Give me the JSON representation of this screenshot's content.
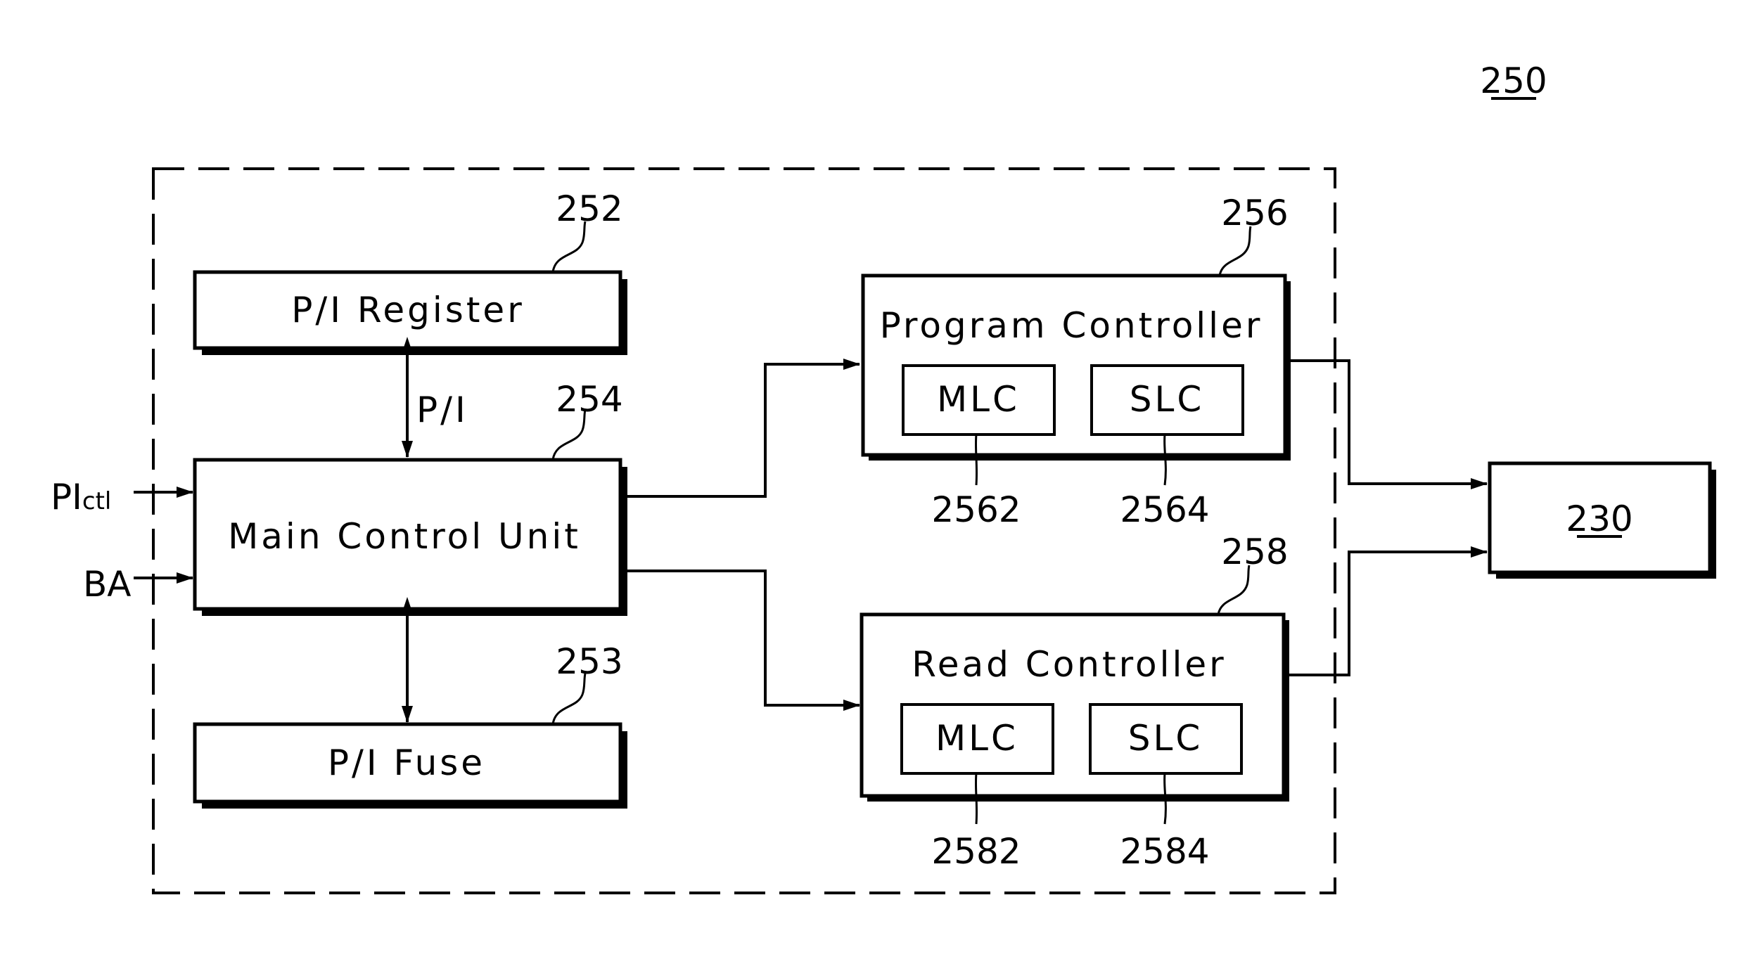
{
  "figure": {
    "ref_number": "250",
    "external_block": {
      "ref": "230"
    },
    "inputs": [
      {
        "label": "PI",
        "subscript": "ctl"
      },
      {
        "label": "BA"
      }
    ],
    "blocks": {
      "pi_register": {
        "label": "P/I Register",
        "ref": "252"
      },
      "main_control_unit": {
        "label": "Main Control Unit",
        "ref": "254"
      },
      "pi_fuse": {
        "label": "P/I Fuse",
        "ref": "253"
      },
      "program_controller": {
        "label": "Program Controller",
        "ref": "256",
        "sub_blocks": [
          {
            "label": "MLC",
            "ref": "2562"
          },
          {
            "label": "SLC",
            "ref": "2564"
          }
        ]
      },
      "read_controller": {
        "label": "Read Controller",
        "ref": "258",
        "sub_blocks": [
          {
            "label": "MLC",
            "ref": "2582"
          },
          {
            "label": "SLC",
            "ref": "2584"
          }
        ]
      }
    },
    "signals": {
      "register_link": "P/I"
    }
  }
}
